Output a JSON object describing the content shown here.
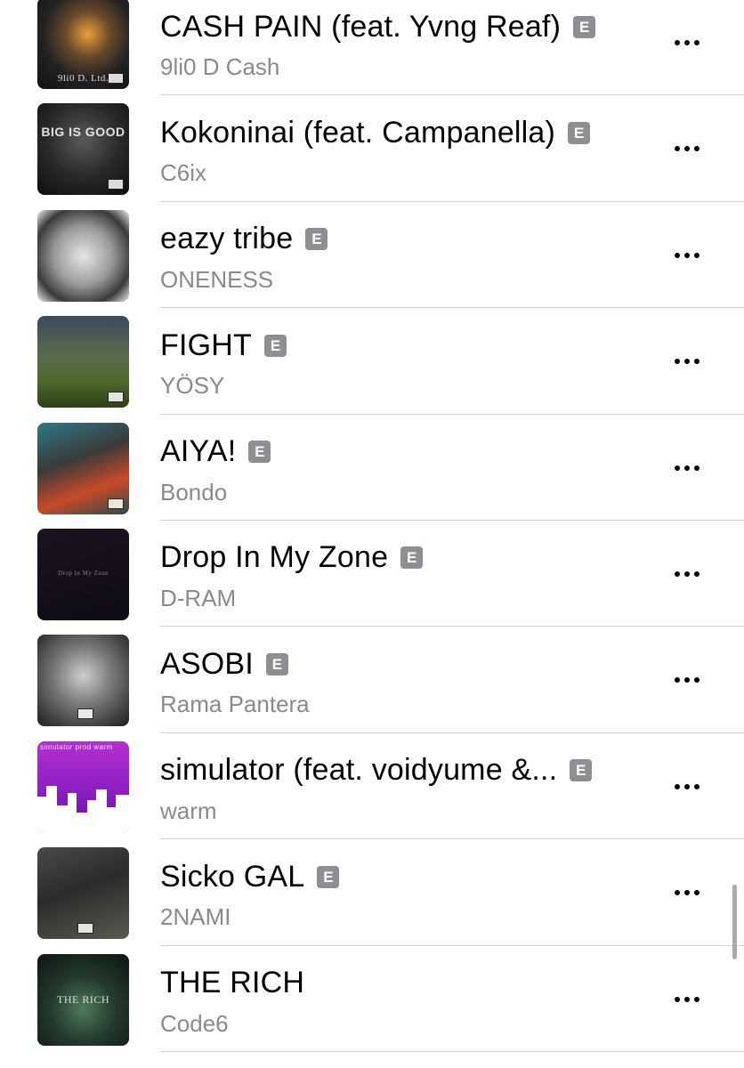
{
  "explicit_badge": "E",
  "songs": [
    {
      "title": "CASH PAIN (feat. Yvng Reaf)",
      "artist": "9li0 D Cash",
      "explicit": true,
      "art_text": "9li0 D. Ltd."
    },
    {
      "title": "Kokoninai (feat. Campanella)",
      "artist": "C6ix",
      "explicit": true,
      "art_text": "BIG IS GOOD"
    },
    {
      "title": "eazy tribe",
      "artist": "ONENESS",
      "explicit": true,
      "art_text": ""
    },
    {
      "title": "FIGHT",
      "artist": "YÖSY",
      "explicit": true,
      "art_text": ""
    },
    {
      "title": "AIYA!",
      "artist": "Bondo",
      "explicit": true,
      "art_text": ""
    },
    {
      "title": "Drop In My Zone",
      "artist": "D-RAM",
      "explicit": true,
      "art_text": "Drop In My Zone"
    },
    {
      "title": "ASOBI",
      "artist": "Rama Pantera",
      "explicit": true,
      "art_text": ""
    },
    {
      "title": "simulator (feat. voidyume &...",
      "artist": "warm",
      "explicit": true,
      "art_text": "simulator prod warm"
    },
    {
      "title": "Sicko GAL",
      "artist": "2NAMI",
      "explicit": true,
      "art_text": ""
    },
    {
      "title": "THE RICH",
      "artist": "Code6",
      "explicit": false,
      "art_text": "THE RICH"
    }
  ],
  "colors": {
    "title": "#000000",
    "artist": "#8a8a8e",
    "badge": "#8e8e93",
    "separator": "#d1d1d6"
  },
  "icons": {
    "more": "more-options-icon",
    "explicit": "explicit-icon"
  }
}
